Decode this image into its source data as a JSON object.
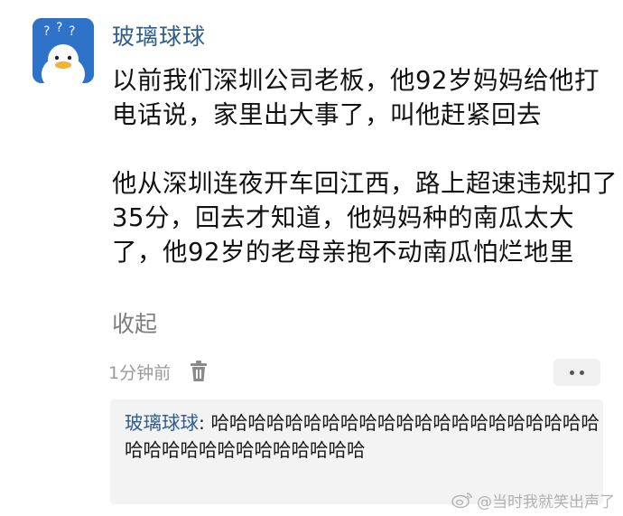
{
  "post": {
    "author": "玻璃球球",
    "paragraphs": [
      "以前我们深圳公司老板，他92岁妈妈给他打电话说，家里出大事了，叫他赶紧回去",
      "他从深圳连夜开车回江西，路上超速违规扣了35分，回去才知道，他妈妈种的南瓜太大了，他92岁的老母亲抱不动南瓜怕烂地里"
    ],
    "collapse_label": "收起",
    "timestamp": "1分钟前"
  },
  "icons": {
    "avatar": "duck-avatar-icon",
    "delete": "trash-icon",
    "more": "more-dots-icon",
    "watermark": "weibo-logo-icon"
  },
  "reply": {
    "author": "玻璃球球",
    "separator": ": ",
    "text": "哈哈哈哈哈哈哈哈哈哈哈哈哈哈哈哈哈哈哈哈哈哈哈哈哈哈哈哈哈哈哈哈哈哈"
  },
  "watermark": {
    "text": "@当时我就笑出声了"
  },
  "colors": {
    "avatar_bg": "#2f73c8",
    "name_link": "#2f5d8a",
    "body_text": "#111111",
    "muted": "#7d7d7d",
    "reply_bg": "#f3f3f3"
  }
}
